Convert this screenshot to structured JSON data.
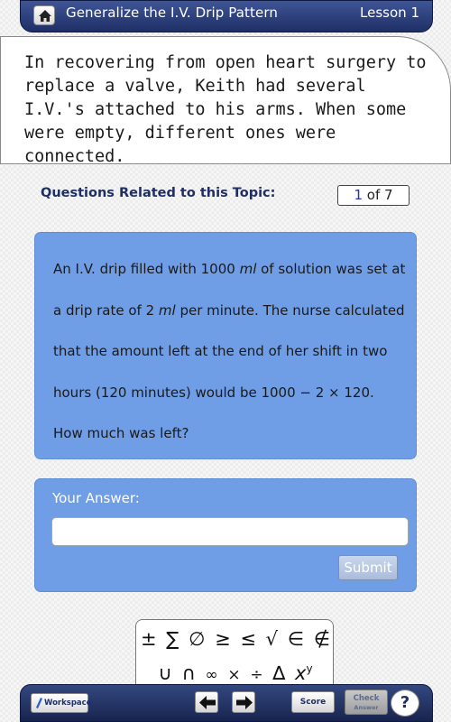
{
  "header": {
    "title": "Generalize the I.V. Drip Pattern",
    "lesson": "Lesson 1",
    "home_icon": "home-icon"
  },
  "intro": {
    "text": "In recovering from open heart surgery to replace a valve, Keith had several I.V.'s attached to his arms. When some were empty, different ones were connected."
  },
  "questions": {
    "heading": "Questions Related to this Topic:",
    "current": "1",
    "of_label": "of 7"
  },
  "question": {
    "part1": "An I.V. drip filled with 1000 ",
    "unit1": "ml",
    "part2": " of solution was set at a drip rate of 2 ",
    "unit2": "ml",
    "part3": " per minute. The nurse calculated that the amount left at the end of her shift in two hours (120 minutes) would be 1000 − 2 × 120. How much was left?"
  },
  "answer": {
    "label": "Your Answer:",
    "value": "",
    "placeholder": "",
    "submit_label": "Submit"
  },
  "symbols": {
    "row1": [
      "±",
      "∑",
      "∅",
      "≥",
      "≤",
      "√",
      "∈",
      "∉"
    ],
    "row2": [
      "∪",
      "∩",
      "∞",
      "×",
      "÷",
      "∆"
    ],
    "xy_base": "x",
    "xy_exp": "y"
  },
  "toolbar": {
    "workspace_label": "Workspace",
    "score_label": "Score",
    "check_label": "Check",
    "check_sub": "Answer",
    "help_label": "?",
    "prev_icon": "arrow-left-icon",
    "next_icon": "arrow-right-icon"
  },
  "colors": {
    "header": "#1f2f66",
    "panel": "#6f9ee6",
    "submit": "#a9bcda"
  }
}
